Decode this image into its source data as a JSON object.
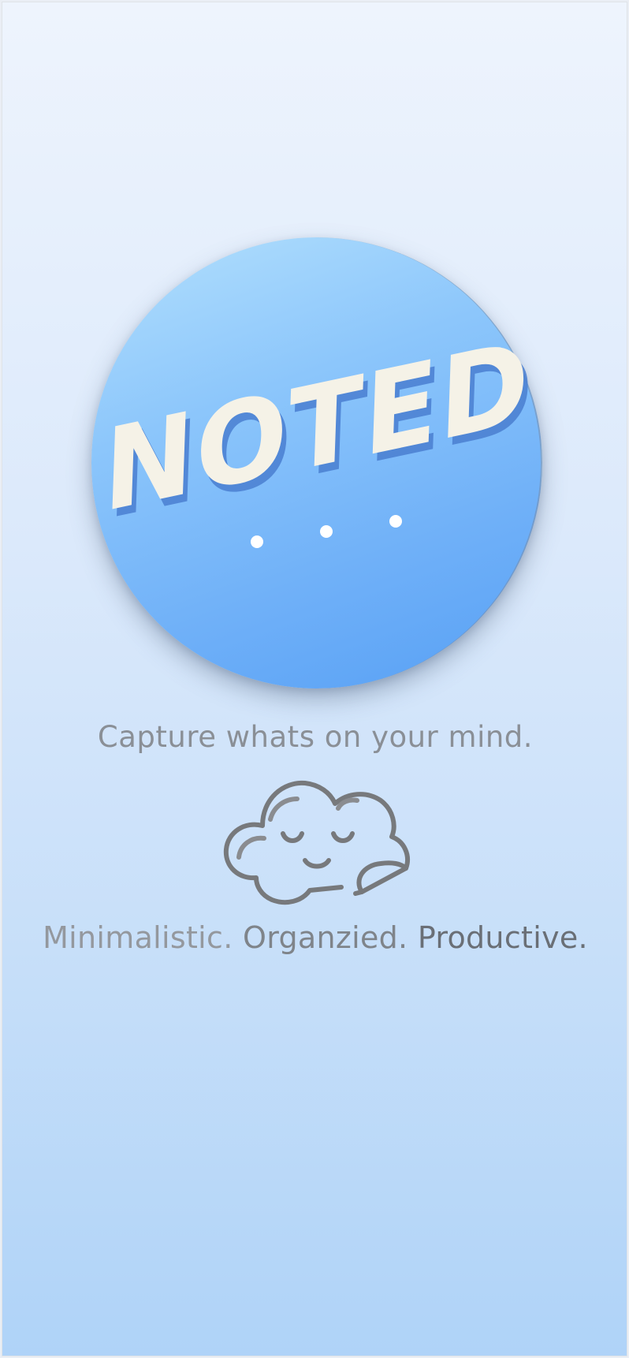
{
  "app": {
    "logo_text": "NOTED",
    "tagline": "Capture whats on your mind.",
    "motto": {
      "words": [
        "Minimalistic.",
        "Organzied.",
        "Productive."
      ]
    }
  },
  "icons": {
    "logo": "noted-logo-icon",
    "cloud": "sleeping-cloud-note-icon"
  },
  "colors": {
    "circle_top": "#b3e0fd",
    "circle_bottom": "#57a0f5",
    "logo_letter": "#f5f2e7",
    "logo_shadow": "#4a7fd1",
    "text_gray": "#8a8f96",
    "icon_gray": "#77797c"
  }
}
